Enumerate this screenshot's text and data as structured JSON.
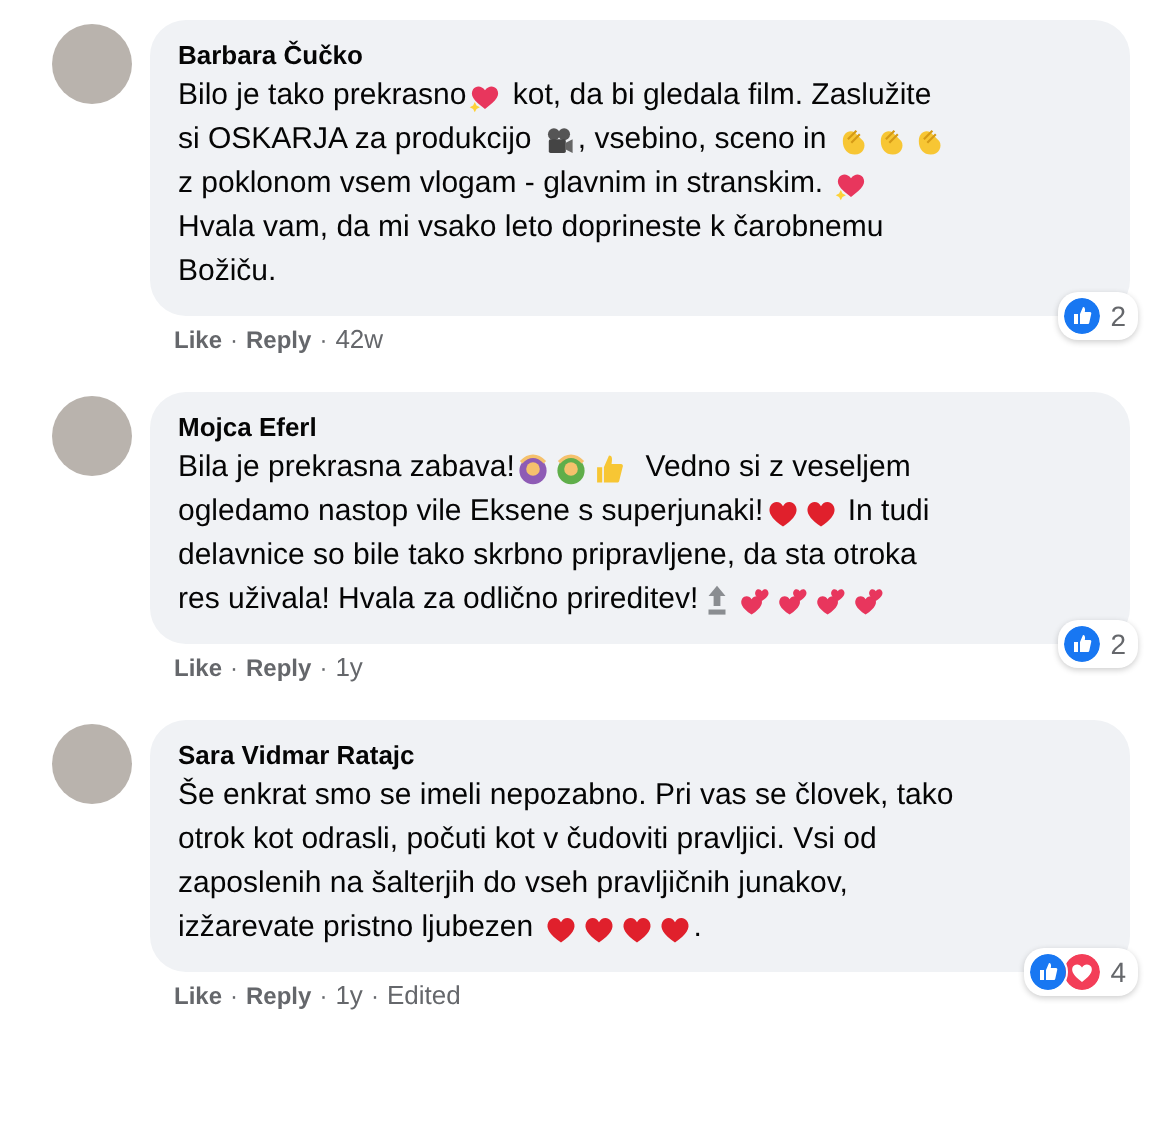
{
  "comments": [
    {
      "author": "Barbara Čučko",
      "body": [
        [
          {
            "kind": "text",
            "text": "Bilo je tako prekrasno"
          },
          {
            "kind": "sparkle-heart"
          },
          {
            "kind": "text",
            "text": " kot, da bi gledala film. Zaslužite"
          }
        ],
        [
          {
            "kind": "text",
            "text": "si OSKARJA za produkcijo "
          },
          {
            "kind": "movie-camera"
          },
          {
            "kind": "text",
            "text": ", vsebino, sceno in "
          },
          {
            "kind": "clap"
          },
          {
            "kind": "clap"
          },
          {
            "kind": "clap"
          }
        ],
        [
          {
            "kind": "text",
            "text": "z poklonom vsem vlogam - glavnim in stranskim. "
          },
          {
            "kind": "sparkle-heart"
          }
        ],
        [
          {
            "kind": "text",
            "text": "Hvala vam, da mi vsako leto doprineste k čarobnemu"
          }
        ],
        [
          {
            "kind": "text",
            "text": "Božiču."
          }
        ]
      ],
      "footer": [
        {
          "kind": "action",
          "text": "Like"
        },
        {
          "kind": "separator",
          "text": "·"
        },
        {
          "kind": "action",
          "text": "Reply"
        },
        {
          "kind": "separator",
          "text": "·"
        },
        {
          "kind": "time",
          "text": "42w"
        }
      ],
      "reactions": [
        {
          "kind": "like"
        }
      ],
      "reaction_count": "2"
    },
    {
      "author": "Mojca Eferl",
      "body": [
        [
          {
            "kind": "text",
            "text": "Bila je prekrasna zabava!"
          },
          {
            "kind": "person-purple"
          },
          {
            "kind": "person-green"
          },
          {
            "kind": "thumbs-up"
          },
          {
            "kind": "text",
            "text": "  Vedno si z veseljem"
          }
        ],
        [
          {
            "kind": "text",
            "text": "ogledamo nastop vile Eksene s superjunaki!"
          },
          {
            "kind": "red-heart"
          },
          {
            "kind": "red-heart"
          },
          {
            "kind": "text",
            "text": " In tudi"
          }
        ],
        [
          {
            "kind": "text",
            "text": "delavnice so bile tako skrbno pripravljene, da sta otroka"
          }
        ],
        [
          {
            "kind": "text",
            "text": "res uživala! Hvala za odlično prireditev!"
          },
          {
            "kind": "top-arrow"
          },
          {
            "kind": "two-hearts"
          },
          {
            "kind": "two-hearts"
          },
          {
            "kind": "two-hearts"
          },
          {
            "kind": "two-hearts"
          }
        ]
      ],
      "footer": [
        {
          "kind": "action",
          "text": "Like"
        },
        {
          "kind": "separator",
          "text": "·"
        },
        {
          "kind": "action",
          "text": "Reply"
        },
        {
          "kind": "separator",
          "text": "·"
        },
        {
          "kind": "time",
          "text": "1y"
        }
      ],
      "reactions": [
        {
          "kind": "like"
        }
      ],
      "reaction_count": "2"
    },
    {
      "author": "Sara Vidmar Ratajc",
      "body": [
        [
          {
            "kind": "text",
            "text": "Še enkrat smo se imeli nepozabno. Pri vas se človek, tako"
          }
        ],
        [
          {
            "kind": "text",
            "text": "otrok kot odrasli, počuti kot v čudoviti pravljici. Vsi od"
          }
        ],
        [
          {
            "kind": "text",
            "text": "zaposlenih na šalterjih do vseh pravljičnih junakov,"
          }
        ],
        [
          {
            "kind": "text",
            "text": "izžarevate pristno ljubezen "
          },
          {
            "kind": "red-heart"
          },
          {
            "kind": "red-heart"
          },
          {
            "kind": "red-heart"
          },
          {
            "kind": "red-heart"
          },
          {
            "kind": "text",
            "text": "."
          }
        ]
      ],
      "footer": [
        {
          "kind": "action",
          "text": "Like"
        },
        {
          "kind": "separator",
          "text": "·"
        },
        {
          "kind": "action",
          "text": "Reply"
        },
        {
          "kind": "separator",
          "text": "·"
        },
        {
          "kind": "time",
          "text": "1y"
        },
        {
          "kind": "separator",
          "text": "·"
        },
        {
          "kind": "edited",
          "text": "Edited"
        }
      ],
      "reactions": [
        {
          "kind": "like"
        },
        {
          "kind": "love"
        }
      ],
      "reaction_count": "4"
    }
  ]
}
